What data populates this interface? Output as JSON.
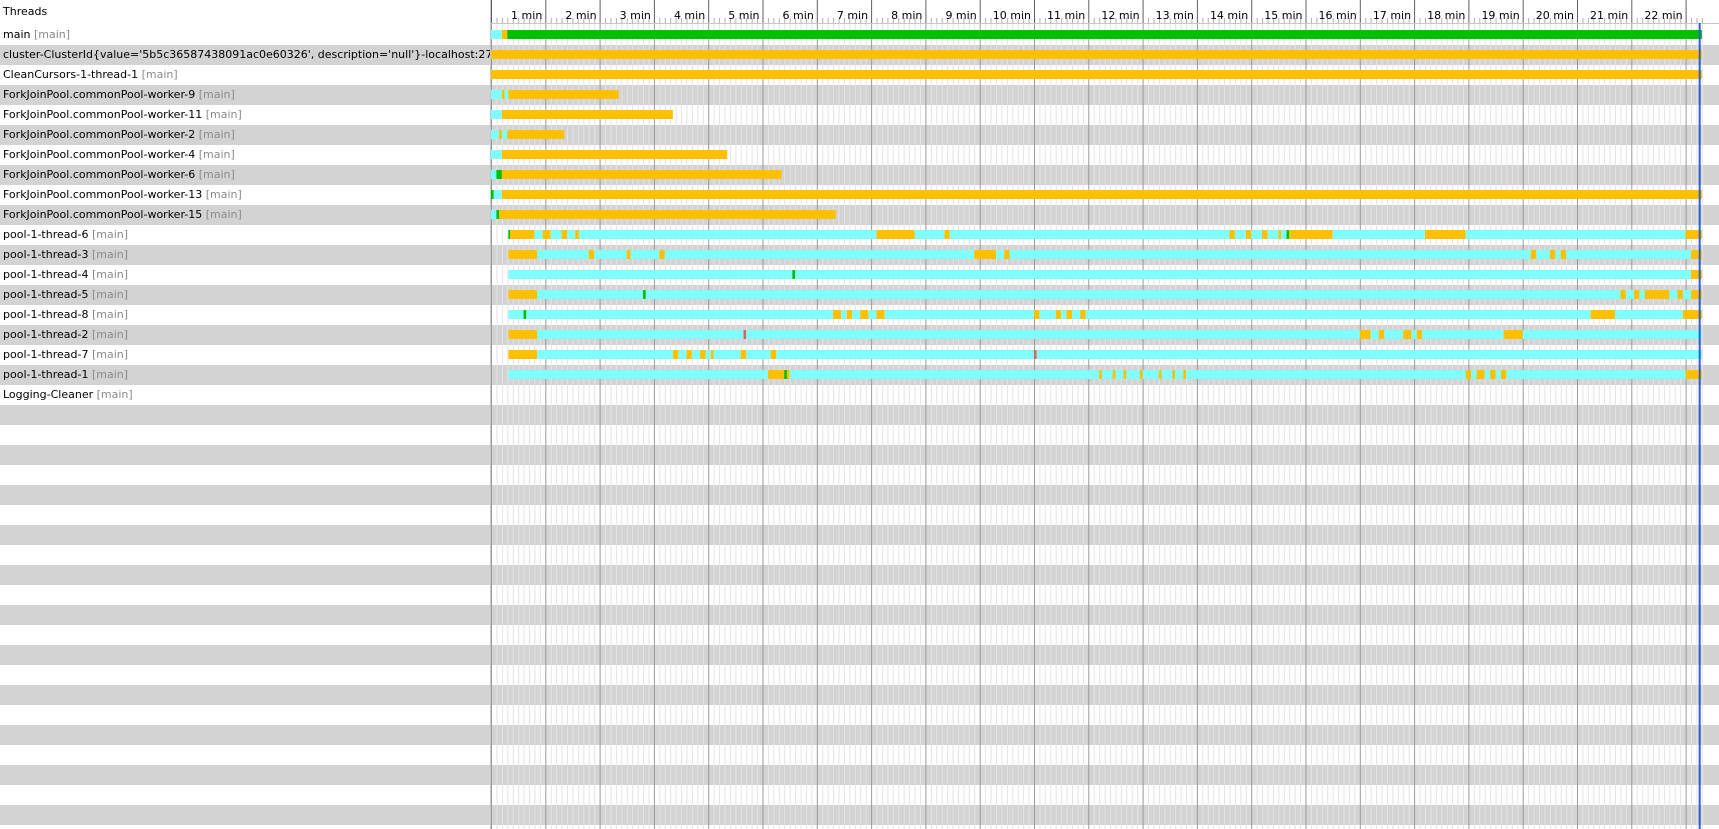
{
  "header": {
    "threads_label": "Threads"
  },
  "axis": {
    "unit_suffix": " min",
    "ticks": [
      "1 min",
      "2 min",
      "3 min",
      "4 min",
      "5 min",
      "6 min",
      "7 min",
      "8 min",
      "9 min",
      "10 min",
      "11 min",
      "12 min",
      "13 min",
      "14 min",
      "15 min",
      "16 min",
      "17 min",
      "18 min",
      "19 min",
      "20 min",
      "21 min",
      "22 min"
    ],
    "max_minutes": 22.3,
    "cursor_minutes": 22.25
  },
  "colors": {
    "running": "#00c000",
    "waiting": "#ffc000",
    "sleeping": "#80ffff",
    "other": "#e06060",
    "cursor": "#2a5fd0",
    "row_alt": "#d3d3d3",
    "group_text": "#8a8a8a"
  },
  "threads": [
    {
      "name": "main",
      "group": "[main]",
      "segments": [
        [
          0.0,
          0.2,
          "sleeping"
        ],
        [
          0.2,
          0.3,
          "waiting"
        ],
        [
          0.3,
          22.3,
          "running"
        ]
      ]
    },
    {
      "name": "cluster-ClusterId{value='5b5c36587438091ac0e60326', description='null'}-localhost:27017",
      "group": "[main]",
      "segments": [
        [
          0.0,
          22.3,
          "waiting"
        ]
      ]
    },
    {
      "name": "CleanCursors-1-thread-1",
      "group": "[main]",
      "segments": [
        [
          0.0,
          22.3,
          "waiting"
        ]
      ]
    },
    {
      "name": "ForkJoinPool.commonPool-worker-9",
      "group": "[main]",
      "segments": [
        [
          0.0,
          0.2,
          "sleeping"
        ],
        [
          0.2,
          0.25,
          "waiting"
        ],
        [
          0.25,
          0.32,
          "sleeping"
        ],
        [
          0.32,
          2.35,
          "waiting"
        ]
      ]
    },
    {
      "name": "ForkJoinPool.commonPool-worker-11",
      "group": "[main]",
      "segments": [
        [
          0.0,
          0.2,
          "sleeping"
        ],
        [
          0.2,
          3.35,
          "waiting"
        ]
      ]
    },
    {
      "name": "ForkJoinPool.commonPool-worker-2",
      "group": "[main]",
      "segments": [
        [
          0.0,
          0.15,
          "sleeping"
        ],
        [
          0.15,
          0.2,
          "waiting"
        ],
        [
          0.2,
          0.3,
          "sleeping"
        ],
        [
          0.3,
          1.35,
          "waiting"
        ]
      ]
    },
    {
      "name": "ForkJoinPool.commonPool-worker-4",
      "group": "[main]",
      "segments": [
        [
          0.0,
          0.2,
          "sleeping"
        ],
        [
          0.2,
          4.35,
          "waiting"
        ]
      ]
    },
    {
      "name": "ForkJoinPool.commonPool-worker-6",
      "group": "[main]",
      "segments": [
        [
          0.0,
          0.1,
          "sleeping"
        ],
        [
          0.1,
          0.2,
          "running"
        ],
        [
          0.2,
          5.35,
          "waiting"
        ]
      ]
    },
    {
      "name": "ForkJoinPool.commonPool-worker-13",
      "group": "[main]",
      "segments": [
        [
          0.0,
          0.05,
          "running"
        ],
        [
          0.05,
          0.2,
          "sleeping"
        ],
        [
          0.2,
          22.3,
          "waiting"
        ]
      ]
    },
    {
      "name": "ForkJoinPool.commonPool-worker-15",
      "group": "[main]",
      "segments": [
        [
          0.0,
          0.1,
          "sleeping"
        ],
        [
          0.1,
          0.15,
          "running"
        ],
        [
          0.15,
          6.35,
          "waiting"
        ]
      ]
    },
    {
      "name": "pool-1-thread-6",
      "group": "[main]",
      "segments": [
        [
          0.32,
          0.35,
          "running"
        ],
        [
          0.35,
          0.8,
          "waiting"
        ],
        [
          0.8,
          0.95,
          "sleeping"
        ],
        [
          0.95,
          1.1,
          "waiting"
        ],
        [
          1.1,
          1.3,
          "sleeping"
        ],
        [
          1.3,
          1.4,
          "waiting"
        ],
        [
          1.4,
          1.55,
          "sleeping"
        ],
        [
          1.55,
          1.62,
          "waiting"
        ],
        [
          1.62,
          7.1,
          "sleeping"
        ],
        [
          7.1,
          7.8,
          "waiting"
        ],
        [
          7.8,
          8.35,
          "sleeping"
        ],
        [
          8.35,
          8.45,
          "waiting"
        ],
        [
          8.45,
          13.6,
          "sleeping"
        ],
        [
          13.6,
          13.7,
          "waiting"
        ],
        [
          13.7,
          13.9,
          "sleeping"
        ],
        [
          13.9,
          14.0,
          "waiting"
        ],
        [
          14.0,
          14.2,
          "sleeping"
        ],
        [
          14.2,
          14.3,
          "waiting"
        ],
        [
          14.3,
          14.5,
          "sleeping"
        ],
        [
          14.5,
          14.55,
          "waiting"
        ],
        [
          14.55,
          14.65,
          "sleeping"
        ],
        [
          14.65,
          14.7,
          "running"
        ],
        [
          14.7,
          15.5,
          "waiting"
        ],
        [
          15.5,
          17.2,
          "sleeping"
        ],
        [
          17.2,
          17.95,
          "waiting"
        ],
        [
          17.95,
          22.0,
          "sleeping"
        ],
        [
          22.0,
          22.3,
          "waiting"
        ]
      ]
    },
    {
      "name": "pool-1-thread-3",
      "group": "[main]",
      "segments": [
        [
          0.32,
          0.85,
          "waiting"
        ],
        [
          0.85,
          1.8,
          "sleeping"
        ],
        [
          1.8,
          1.9,
          "waiting"
        ],
        [
          1.9,
          2.5,
          "sleeping"
        ],
        [
          2.5,
          2.57,
          "waiting"
        ],
        [
          2.57,
          3.1,
          "sleeping"
        ],
        [
          3.1,
          3.2,
          "waiting"
        ],
        [
          3.2,
          8.9,
          "sleeping"
        ],
        [
          8.9,
          9.3,
          "waiting"
        ],
        [
          9.3,
          9.45,
          "sleeping"
        ],
        [
          9.45,
          9.55,
          "waiting"
        ],
        [
          9.55,
          19.15,
          "sleeping"
        ],
        [
          19.15,
          19.25,
          "waiting"
        ],
        [
          19.25,
          19.5,
          "sleeping"
        ],
        [
          19.5,
          19.6,
          "waiting"
        ],
        [
          19.6,
          19.7,
          "sleeping"
        ],
        [
          19.7,
          19.8,
          "waiting"
        ],
        [
          19.8,
          22.1,
          "sleeping"
        ],
        [
          22.1,
          22.3,
          "waiting"
        ]
      ]
    },
    {
      "name": "pool-1-thread-4",
      "group": "[main]",
      "segments": [
        [
          0.32,
          5.55,
          "sleeping"
        ],
        [
          5.55,
          5.6,
          "running"
        ],
        [
          5.6,
          22.1,
          "sleeping"
        ],
        [
          22.1,
          22.3,
          "waiting"
        ]
      ]
    },
    {
      "name": "pool-1-thread-5",
      "group": "[main]",
      "segments": [
        [
          0.32,
          0.85,
          "waiting"
        ],
        [
          0.85,
          2.8,
          "sleeping"
        ],
        [
          2.8,
          2.85,
          "running"
        ],
        [
          2.85,
          20.8,
          "sleeping"
        ],
        [
          20.8,
          20.9,
          "waiting"
        ],
        [
          20.9,
          21.05,
          "sleeping"
        ],
        [
          21.05,
          21.15,
          "waiting"
        ],
        [
          21.15,
          21.25,
          "sleeping"
        ],
        [
          21.25,
          21.7,
          "waiting"
        ],
        [
          21.7,
          21.85,
          "sleeping"
        ],
        [
          21.85,
          21.95,
          "waiting"
        ],
        [
          21.95,
          22.1,
          "sleeping"
        ],
        [
          22.1,
          22.3,
          "waiting"
        ]
      ]
    },
    {
      "name": "pool-1-thread-8",
      "group": "[main]",
      "segments": [
        [
          0.32,
          0.6,
          "sleeping"
        ],
        [
          0.6,
          0.65,
          "running"
        ],
        [
          0.65,
          6.3,
          "sleeping"
        ],
        [
          6.3,
          6.45,
          "waiting"
        ],
        [
          6.45,
          6.55,
          "sleeping"
        ],
        [
          6.55,
          6.65,
          "waiting"
        ],
        [
          6.65,
          6.8,
          "sleeping"
        ],
        [
          6.8,
          6.95,
          "waiting"
        ],
        [
          6.95,
          7.1,
          "sleeping"
        ],
        [
          7.1,
          7.25,
          "waiting"
        ],
        [
          7.25,
          10.0,
          "sleeping"
        ],
        [
          10.0,
          10.1,
          "waiting"
        ],
        [
          10.1,
          10.4,
          "sleeping"
        ],
        [
          10.4,
          10.5,
          "waiting"
        ],
        [
          10.5,
          10.6,
          "sleeping"
        ],
        [
          10.6,
          10.7,
          "waiting"
        ],
        [
          10.7,
          10.85,
          "sleeping"
        ],
        [
          10.85,
          10.95,
          "waiting"
        ],
        [
          10.95,
          20.25,
          "sleeping"
        ],
        [
          20.25,
          20.7,
          "waiting"
        ],
        [
          20.7,
          21.95,
          "sleeping"
        ],
        [
          21.95,
          22.3,
          "waiting"
        ]
      ]
    },
    {
      "name": "pool-1-thread-2",
      "group": "[main]",
      "segments": [
        [
          0.32,
          0.85,
          "waiting"
        ],
        [
          0.85,
          4.65,
          "sleeping"
        ],
        [
          4.65,
          4.7,
          "other"
        ],
        [
          4.7,
          16.0,
          "sleeping"
        ],
        [
          16.0,
          16.2,
          "waiting"
        ],
        [
          16.2,
          16.35,
          "sleeping"
        ],
        [
          16.35,
          16.45,
          "waiting"
        ],
        [
          16.45,
          16.8,
          "sleeping"
        ],
        [
          16.8,
          16.95,
          "waiting"
        ],
        [
          16.95,
          17.05,
          "sleeping"
        ],
        [
          17.05,
          17.15,
          "waiting"
        ],
        [
          17.15,
          18.65,
          "sleeping"
        ],
        [
          18.65,
          19.0,
          "waiting"
        ],
        [
          19.0,
          22.3,
          "sleeping"
        ]
      ]
    },
    {
      "name": "pool-1-thread-7",
      "group": "[main]",
      "segments": [
        [
          0.32,
          0.85,
          "waiting"
        ],
        [
          0.85,
          3.35,
          "sleeping"
        ],
        [
          3.35,
          3.45,
          "waiting"
        ],
        [
          3.45,
          3.6,
          "sleeping"
        ],
        [
          3.6,
          3.7,
          "waiting"
        ],
        [
          3.7,
          3.85,
          "sleeping"
        ],
        [
          3.85,
          3.95,
          "waiting"
        ],
        [
          3.95,
          4.05,
          "sleeping"
        ],
        [
          4.05,
          4.1,
          "waiting"
        ],
        [
          4.1,
          4.6,
          "sleeping"
        ],
        [
          4.6,
          4.7,
          "waiting"
        ],
        [
          4.7,
          5.15,
          "sleeping"
        ],
        [
          5.15,
          5.25,
          "waiting"
        ],
        [
          5.25,
          10.0,
          "sleeping"
        ],
        [
          10.0,
          10.05,
          "other"
        ],
        [
          10.05,
          22.3,
          "sleeping"
        ]
      ]
    },
    {
      "name": "pool-1-thread-1",
      "group": "[main]",
      "segments": [
        [
          0.32,
          5.1,
          "sleeping"
        ],
        [
          5.1,
          5.4,
          "waiting"
        ],
        [
          5.4,
          5.45,
          "running"
        ],
        [
          5.45,
          5.5,
          "waiting"
        ],
        [
          5.5,
          11.2,
          "sleeping"
        ],
        [
          11.2,
          11.25,
          "waiting"
        ],
        [
          11.25,
          11.45,
          "sleeping"
        ],
        [
          11.45,
          11.5,
          "waiting"
        ],
        [
          11.5,
          11.65,
          "sleeping"
        ],
        [
          11.65,
          11.7,
          "waiting"
        ],
        [
          11.7,
          11.95,
          "sleeping"
        ],
        [
          11.95,
          12.0,
          "waiting"
        ],
        [
          12.0,
          12.3,
          "sleeping"
        ],
        [
          12.3,
          12.35,
          "waiting"
        ],
        [
          12.35,
          12.55,
          "sleeping"
        ],
        [
          12.55,
          12.6,
          "waiting"
        ],
        [
          12.6,
          12.75,
          "sleeping"
        ],
        [
          12.75,
          12.8,
          "waiting"
        ],
        [
          12.8,
          17.95,
          "sleeping"
        ],
        [
          17.95,
          18.05,
          "waiting"
        ],
        [
          18.05,
          18.15,
          "sleeping"
        ],
        [
          18.15,
          18.3,
          "waiting"
        ],
        [
          18.3,
          18.4,
          "sleeping"
        ],
        [
          18.4,
          18.5,
          "waiting"
        ],
        [
          18.5,
          18.6,
          "sleeping"
        ],
        [
          18.6,
          18.7,
          "waiting"
        ],
        [
          18.7,
          22.0,
          "sleeping"
        ],
        [
          22.0,
          22.3,
          "waiting"
        ]
      ]
    },
    {
      "name": "Logging-Cleaner",
      "group": "[main]",
      "segments": []
    }
  ]
}
